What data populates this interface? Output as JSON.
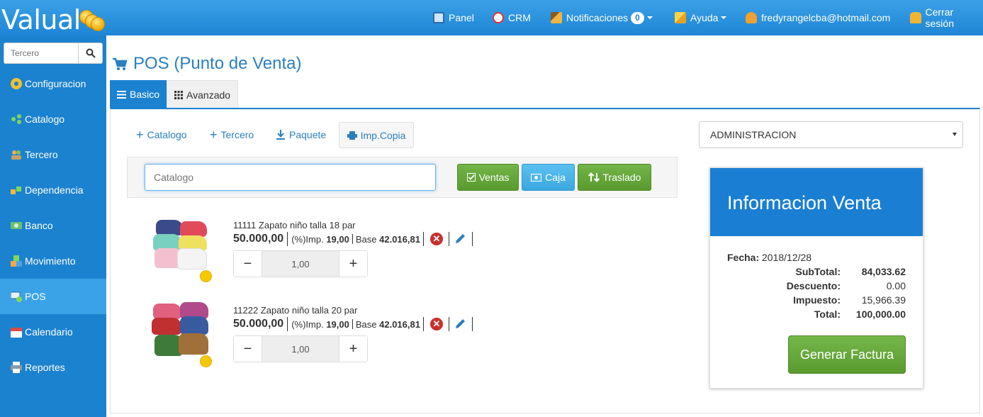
{
  "app": {
    "logo_text": "Valual"
  },
  "header": {
    "nav": [
      {
        "label": "Panel",
        "icon": "monitor-icon"
      },
      {
        "label": "CRM",
        "icon": "crm-icon"
      },
      {
        "label": "Notificaciones",
        "icon": "broom-icon",
        "badge": "0"
      },
      {
        "label": "Ayuda",
        "icon": "pencil-help-icon"
      },
      {
        "label": "fredyrangelcba@hotmail.com",
        "icon": "user-icon"
      },
      {
        "label": "Cerrar sesión",
        "icon": "lock-icon"
      }
    ]
  },
  "sidebar": {
    "search_placeholder": "Tercero",
    "items": [
      {
        "label": "Configuracion",
        "icon": "gear-icon"
      },
      {
        "label": "Catalogo",
        "icon": "catalog-icon"
      },
      {
        "label": "Tercero",
        "icon": "people-icon"
      },
      {
        "label": "Dependencia",
        "icon": "blocks-icon"
      },
      {
        "label": "Banco",
        "icon": "money-icon"
      },
      {
        "label": "Movimiento",
        "icon": "boxes-icon"
      },
      {
        "label": "POS",
        "icon": "pos-icon",
        "active": true
      },
      {
        "label": "Calendario",
        "icon": "calendar-icon"
      },
      {
        "label": "Reportes",
        "icon": "printer-icon"
      }
    ]
  },
  "page": {
    "title": "POS (Punto de Venta)",
    "tabs": [
      {
        "label": "Basico",
        "active": true
      },
      {
        "label": "Avanzado",
        "active": false
      }
    ]
  },
  "actions": {
    "catalogo": "Catalogo",
    "tercero": "Tercero",
    "paquete": "Paquete",
    "imp_copia": "Imp.Copia"
  },
  "search": {
    "placeholder": "Catalogo",
    "ventas": "Ventas",
    "caja": "Caja",
    "traslado": "Traslado"
  },
  "products": [
    {
      "name": "11111 Zapato niño talla 18 par",
      "price": "50.000,00",
      "imp_label": "(%)Imp.",
      "imp_value": "19,00",
      "base_label": "Base",
      "base_value": "42.016,81",
      "qty": "1,00"
    },
    {
      "name": "11222 Zapato niño talla 20 par",
      "price": "50.000,00",
      "imp_label": "(%)Imp.",
      "imp_value": "19,00",
      "base_label": "Base",
      "base_value": "42.016,81",
      "qty": "1,00"
    }
  ],
  "dependency_select": "ADMINISTRACION",
  "sale_info": {
    "title": "Informacion Venta",
    "fecha_label": "Fecha:",
    "fecha": "2018/12/28",
    "subtotal_label": "SubTotal:",
    "subtotal": "84,033.62",
    "descuento_label": "Descuento:",
    "descuento": "0.00",
    "impuesto_label": "Impuesto:",
    "impuesto": "15,966.39",
    "total_label": "Total:",
    "total": "100,000.00",
    "generate_button": "Generar Factura"
  },
  "colors": {
    "primary": "#1b82d0",
    "green": "#5a9a2f",
    "info": "#3aa8e0",
    "danger": "#c9302c"
  }
}
